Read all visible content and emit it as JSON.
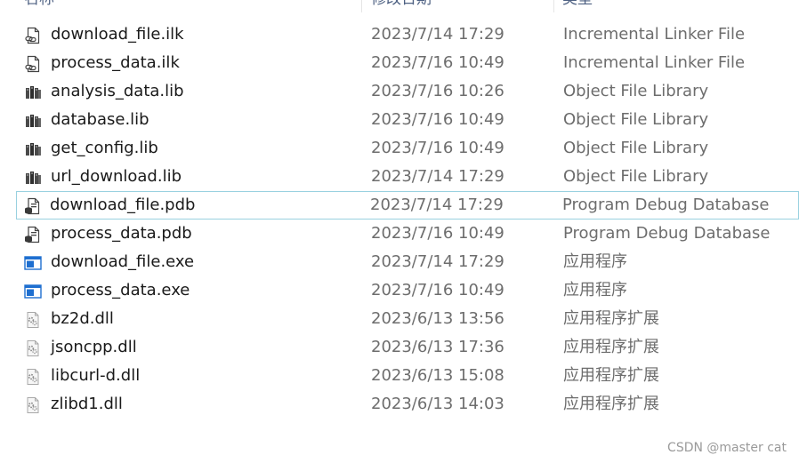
{
  "header": {
    "columns": [
      "名称",
      "修改日期",
      "类型"
    ]
  },
  "files": [
    {
      "name": "download_file.ilk",
      "date": "2023/7/14 17:29",
      "type": "Incremental Linker File",
      "icon": "ilk-file-icon"
    },
    {
      "name": "process_data.ilk",
      "date": "2023/7/16 10:49",
      "type": "Incremental Linker File",
      "icon": "ilk-file-icon"
    },
    {
      "name": "analysis_data.lib",
      "date": "2023/7/16 10:26",
      "type": "Object File Library",
      "icon": "library-icon"
    },
    {
      "name": "database.lib",
      "date": "2023/7/16 10:49",
      "type": "Object File Library",
      "icon": "library-icon"
    },
    {
      "name": "get_config.lib",
      "date": "2023/7/16 10:49",
      "type": "Object File Library",
      "icon": "library-icon"
    },
    {
      "name": "url_download.lib",
      "date": "2023/7/14 17:29",
      "type": "Object File Library",
      "icon": "library-icon"
    },
    {
      "name": "download_file.pdb",
      "date": "2023/7/14 17:29",
      "type": "Program Debug Database",
      "icon": "pdb-file-icon",
      "focused": true
    },
    {
      "name": "process_data.pdb",
      "date": "2023/7/16 10:49",
      "type": "Program Debug Database",
      "icon": "pdb-file-icon"
    },
    {
      "name": "download_file.exe",
      "date": "2023/7/14 17:29",
      "type": "应用程序",
      "icon": "exe-file-icon"
    },
    {
      "name": "process_data.exe",
      "date": "2023/7/16 10:49",
      "type": "应用程序",
      "icon": "exe-file-icon"
    },
    {
      "name": "bz2d.dll",
      "date": "2023/6/13 13:56",
      "type": "应用程序扩展",
      "icon": "dll-file-icon"
    },
    {
      "name": "jsoncpp.dll",
      "date": "2023/6/13 17:36",
      "type": "应用程序扩展",
      "icon": "dll-file-icon"
    },
    {
      "name": "libcurl-d.dll",
      "date": "2023/6/13 15:08",
      "type": "应用程序扩展",
      "icon": "dll-file-icon"
    },
    {
      "name": "zlibd1.dll",
      "date": "2023/6/13 14:03",
      "type": "应用程序扩展",
      "icon": "dll-file-icon"
    }
  ],
  "watermark": "CSDN @master cat",
  "colors": {
    "focus_border": "#99d1e0",
    "exe_blue": "#1e6fd0",
    "header_text": "#4d6082"
  }
}
